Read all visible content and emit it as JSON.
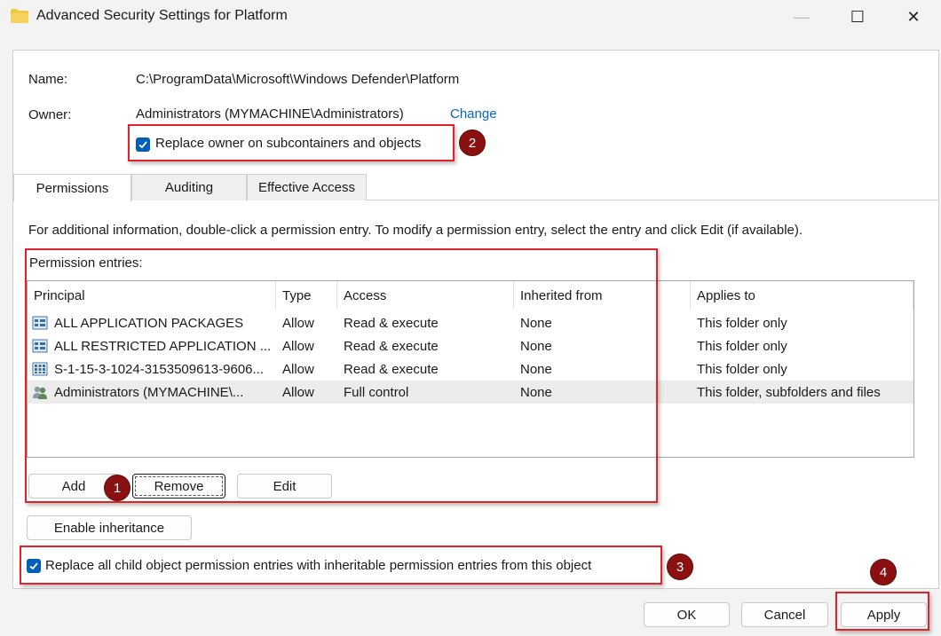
{
  "window": {
    "title": "Advanced Security Settings for Platform",
    "minimize_glyph": "—",
    "maximize_glyph": "☐",
    "close_glyph": "✕"
  },
  "name": {
    "label": "Name:",
    "value": "C:\\ProgramData\\Microsoft\\Windows Defender\\Platform"
  },
  "owner": {
    "label": "Owner:",
    "value": "Administrators (MYMACHINE\\Administrators)",
    "change_link": "Change"
  },
  "replace_owner": {
    "label": "Replace owner on subcontainers and objects",
    "checked": true
  },
  "tabs": [
    {
      "label": "Permissions",
      "active": true
    },
    {
      "label": "Auditing",
      "active": false
    },
    {
      "label": "Effective Access",
      "active": false
    }
  ],
  "info_text": "For additional information, double-click a permission entry. To modify a permission entry, select the entry and click Edit (if available).",
  "entries_label": "Permission entries:",
  "columns": [
    "Principal",
    "Type",
    "Access",
    "Inherited from",
    "Applies to"
  ],
  "rows": [
    {
      "icon": "app-package-icon",
      "principal": "ALL APPLICATION PACKAGES",
      "type": "Allow",
      "access": "Read & execute",
      "inherited": "None",
      "applies": "This folder only"
    },
    {
      "icon": "app-package-icon",
      "principal": "ALL RESTRICTED APPLICATION ...",
      "type": "Allow",
      "access": "Read & execute",
      "inherited": "None",
      "applies": "This folder only"
    },
    {
      "icon": "sid-icon",
      "principal": "S-1-15-3-1024-3153509613-9606...",
      "type": "Allow",
      "access": "Read & execute",
      "inherited": "None",
      "applies": "This folder only"
    },
    {
      "icon": "group-icon",
      "principal": "Administrators (MYMACHINE\\...",
      "type": "Allow",
      "access": "Full control",
      "inherited": "None",
      "applies": "This folder, subfolders and files"
    }
  ],
  "buttons": {
    "add": "Add",
    "remove": "Remove",
    "edit": "Edit",
    "enable_inheritance": "Enable inheritance",
    "ok": "OK",
    "cancel": "Cancel",
    "apply": "Apply"
  },
  "replace_child": {
    "label": "Replace all child object permission entries with inheritable permission entries from this object",
    "checked": true
  },
  "badges": [
    "1",
    "2",
    "3",
    "4"
  ],
  "colors": {
    "accent": "#005fb8",
    "link": "#0067c0",
    "annotation": "#e0232a",
    "badge": "#8b1010"
  }
}
